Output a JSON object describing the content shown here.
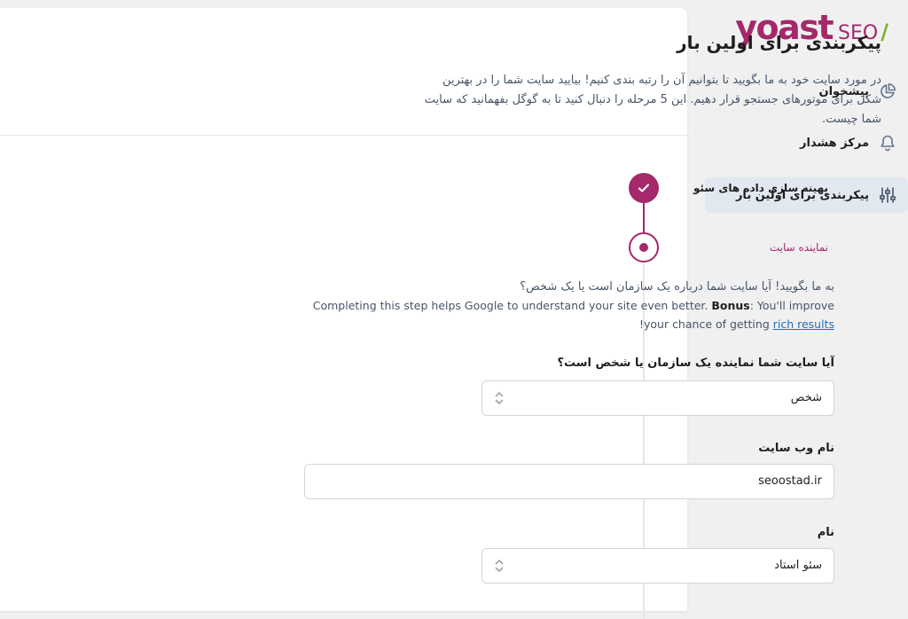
{
  "brand": {
    "logo_word": "yoast",
    "logo_seo": "SEO",
    "logo_slash": "/",
    "colors": {
      "primary": "#a4286a",
      "accent": "#77b227"
    }
  },
  "sidebar": {
    "items": [
      {
        "label": "پیشخوان",
        "icon": "dashboard-icon",
        "active": false
      },
      {
        "label": "مرکز هشدار",
        "icon": "bell-icon",
        "active": false
      },
      {
        "label": "پیکربندی برای اولین بار",
        "icon": "sliders-icon",
        "active": true
      }
    ]
  },
  "main": {
    "title": "پیکربندی برای اولین بار",
    "description": "در مورد سایت خود به ما بگویید تا بتوانیم آن را رتبه بندی کنیم! بیایید سایت شما را در بهترین شکل برای موتورهای جستجو قرار دهیم. این 5 مرحله را دنبال کنید تا به گوگل بفهمانید که سایت شما چیست."
  },
  "steps": [
    {
      "label": "بهینه سازی داده های سئو",
      "state": "done"
    },
    {
      "label": "نماینده سایت",
      "state": "active"
    }
  ],
  "site_representation": {
    "intro_fa": "به ما بگویید! آیا سایت شما درباره یک سازمان است یا یک شخص؟",
    "intro_en_1": "Completing this step helps Google to understand your site even better. ",
    "intro_en_bold": "Bonus",
    "intro_en_2": ": You'll improve your chance of getting ",
    "intro_en_link": "rich results",
    "intro_en_3": "!",
    "fields": {
      "type_question": "آیا سایت شما نماینده یک سازمان یا شخص است؟",
      "type_value": "شخص",
      "website_name_label": "نام وب سایت",
      "website_name_value": "seoostad.ir",
      "name_label": "نام",
      "name_value": "سئو استاد"
    }
  }
}
